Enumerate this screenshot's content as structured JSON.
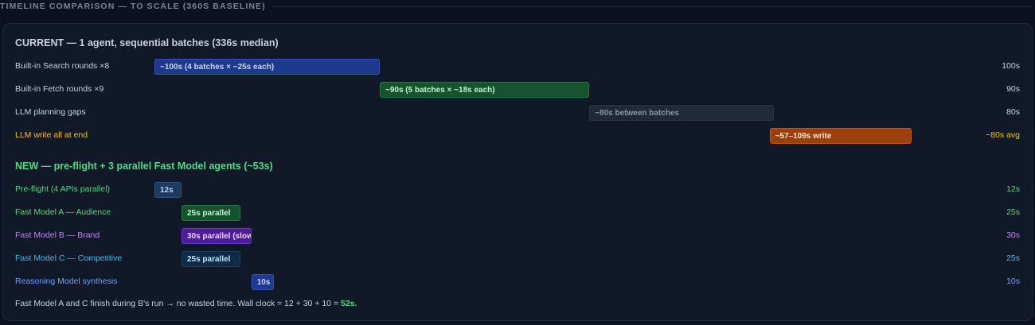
{
  "section": {
    "title": "TIMELINE COMPARISON — TO SCALE (360S BASELINE)"
  },
  "scale": {
    "baseline_seconds": 360
  },
  "current": {
    "title": "CURRENT — 1 agent, sequential batches (336s median)",
    "title_color": "#c9d1dc",
    "rows": [
      {
        "label": "Built-in Search rounds ×8",
        "bar_label": "~100s (4 batches × ~25s each)",
        "start": 0,
        "duration": 100,
        "value": "100s",
        "bar_color": "#1e3a8a",
        "bar_border": "#2d52b8",
        "bar_text_color": "#c7d4f7",
        "label_color": "#c9d1dc",
        "value_color": "#c9d1dc"
      },
      {
        "label": "Built-in Fetch rounds ×9",
        "bar_label": "~90s (5 batches × ~18s each)",
        "start": 100,
        "duration": 93,
        "value": "90s",
        "bar_color": "#14532d",
        "bar_border": "#1f7a3f",
        "bar_text_color": "#bbf7d0",
        "label_color": "#c9d1dc",
        "value_color": "#c9d1dc"
      },
      {
        "label": "LLM planning gaps",
        "bar_label": "~80s between batches",
        "start": 193,
        "duration": 82,
        "value": "80s",
        "bar_color": "#1f2937",
        "bar_border": "#2b3647",
        "bar_text_color": "#8b96a8",
        "label_color": "#c9d1dc",
        "value_color": "#c9d1dc"
      },
      {
        "label": "LLM write all at end",
        "bar_label": "~57–109s write",
        "start": 273,
        "duration": 63,
        "value": "~80s avg",
        "bar_color": "#9a3f0e",
        "bar_border": "#c2541a",
        "bar_text_color": "#fde7d2",
        "label_color": "#fbbf24",
        "value_color": "#fbbf24"
      }
    ]
  },
  "new": {
    "title": "NEW — pre-flight + 3 parallel Fast Model agents (~53s)",
    "title_color": "#4ade80",
    "rows": [
      {
        "label": "Pre-flight (4 APIs parallel)",
        "bar_label": "12s",
        "start": 0,
        "duration": 12,
        "value": "12s",
        "bar_color": "#1e3a5f",
        "bar_border": "#2a5180",
        "bar_text_color": "#bcd4f2",
        "label_color": "#4ade80",
        "value_color": "#4ade80"
      },
      {
        "label": "Fast Model A — Audience",
        "bar_label": "25s parallel",
        "start": 12,
        "duration": 26,
        "value": "25s",
        "bar_color": "#14532d",
        "bar_border": "#1f7a3f",
        "bar_text_color": "#bbf7d0",
        "label_color": "#4ade80",
        "value_color": "#4ade80"
      },
      {
        "label": "Fast Model B — Brand",
        "bar_label": "30s parallel (slowest)",
        "start": 12,
        "duration": 31,
        "value": "30s",
        "bar_color": "#4c1d95",
        "bar_border": "#6b2fd1",
        "bar_text_color": "#e9d5ff",
        "label_color": "#c084fc",
        "value_color": "#c084fc"
      },
      {
        "label": "Fast Model C — Competitive",
        "bar_label": "25s parallel",
        "start": 12,
        "duration": 26,
        "value": "25s",
        "bar_color": "#0f2a44",
        "bar_border": "#1a3f63",
        "bar_text_color": "#bae6fd",
        "label_color": "#38bdf8",
        "value_color": "#38bdf8"
      },
      {
        "label": "Reasoning Model synthesis",
        "bar_label": "10s",
        "start": 43,
        "duration": 10,
        "value": "10s",
        "bar_color": "#1e3a8a",
        "bar_border": "#2d52b8",
        "bar_text_color": "#c7d4f7",
        "label_color": "#60a5fa",
        "value_color": "#60a5fa"
      }
    ]
  },
  "footer": {
    "text": "Fast Model A and C finish during B's run → no wasted time. Wall clock = 12 + 30 + 10 = ",
    "highlight": "52s."
  }
}
